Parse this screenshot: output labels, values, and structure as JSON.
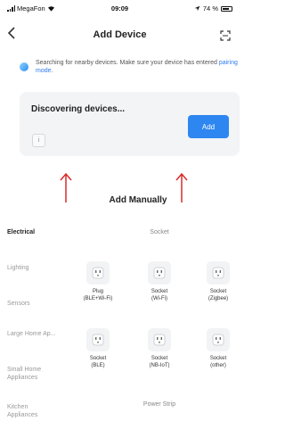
{
  "status_bar": {
    "carrier": "MegaFon",
    "time": "09:09",
    "battery": "74 %",
    "battery_level": 0.74
  },
  "header": {
    "title": "Add Device",
    "back_icon": "chevron-left-icon",
    "scan_icon": "scan-icon"
  },
  "search_note": {
    "text": "Searching for nearby devices. Make sure your device has entered ",
    "link": "pairing mode",
    "suffix": "."
  },
  "discover": {
    "title": "Discovering devices...",
    "add_label": "Add",
    "info_label": "i"
  },
  "manual": {
    "title": "Add Manually"
  },
  "sidebar": {
    "items": [
      {
        "label": "Electrical"
      },
      {
        "label": "Lighting"
      },
      {
        "label": "Sensors"
      },
      {
        "label": "Large Home Ap..."
      },
      {
        "label": "Small Home Appliances"
      },
      {
        "label": "Kitchen Appliances"
      }
    ]
  },
  "groups": {
    "socket": "Socket",
    "power_strip": "Power Strip"
  },
  "devices": [
    {
      "line1": "Plug",
      "line2": "(BLE+Wi-Fi)"
    },
    {
      "line1": "Socket",
      "line2": "(Wi-Fi)"
    },
    {
      "line1": "Socket",
      "line2": "(Zigbee)"
    },
    {
      "line1": "Socket",
      "line2": "(BLE)"
    },
    {
      "line1": "Socket",
      "line2": "(NB-IoT)"
    },
    {
      "line1": "Socket",
      "line2": "(other)"
    }
  ],
  "colors": {
    "accent": "#2e86f0",
    "arrow": "#d92b2b",
    "card": "#f3f4f6"
  }
}
